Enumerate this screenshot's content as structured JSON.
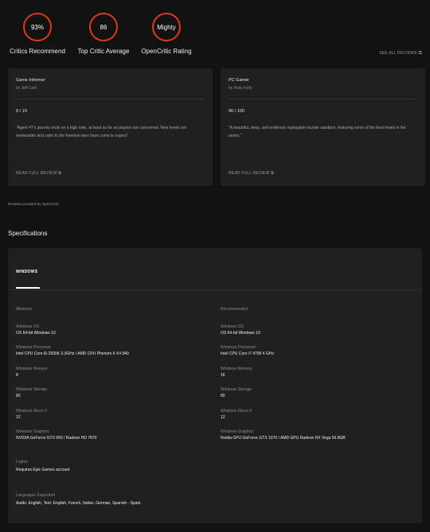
{
  "ratings": [
    {
      "value": "93%",
      "label": "Critics Recommend"
    },
    {
      "value": "86",
      "label": "Top Critic Average"
    },
    {
      "value": "Mighty",
      "label": "OpenCritic Rating"
    }
  ],
  "see_all_reviews": "SEE ALL REVIEWS",
  "reviews": [
    {
      "outlet": "Game Informer",
      "author": "by Jeff Cork",
      "score": "9 / 10",
      "quote": "“Agent 47’s journey ends on a high note, at least as far as players are concerned. New levels are memorable and cater to the freedom fans have come to expect”",
      "read_label": "READ FULL REVIEW"
    },
    {
      "outlet": "PC Gamer",
      "author": "by Andy Kelly",
      "score": "90 / 100",
      "quote": "“A beautiful, deep, and endlessly replayable murder sandbox, featuring some of the best levels in the series.”",
      "read_label": "READ FULL REVIEW"
    }
  ],
  "provided_by": "Reviews provided by OpenCritic",
  "specifications": {
    "title": "Specifications",
    "platform_tab": "WINDOWS",
    "minimum": {
      "heading": "Minimum",
      "items": [
        {
          "label": "Windows OS",
          "value": "OS 64-bit Windows 10"
        },
        {
          "label": "Windows Processor",
          "value": "Intel CPU Core i5-2500K 3.3GHz / AMD CPU Phenom II X4 940"
        },
        {
          "label": "Windows Memory",
          "value": "8"
        },
        {
          "label": "Windows Storage",
          "value": "80"
        },
        {
          "label": "Windows Direct X",
          "value": "12"
        },
        {
          "label": "Windows Graphics",
          "value": "NVIDIA GeForce GTX 660 / Radeon HD 7870"
        }
      ]
    },
    "recommended": {
      "heading": "Recommended",
      "items": [
        {
          "label": "Windows OS",
          "value": "OS 64-bit Windows 10"
        },
        {
          "label": "Windows Processor",
          "value": "Intel CPU Core i7 4790 4 GHz"
        },
        {
          "label": "Windows Memory",
          "value": "16"
        },
        {
          "label": "Windows Storage",
          "value": "80"
        },
        {
          "label": "Windows Direct X",
          "value": "12"
        },
        {
          "label": "Windows Graphics",
          "value": "Nvidia GPU GeForce GTX 1070 / AMD GPU Radeon RX Vega 56 8GB"
        }
      ]
    },
    "logins": {
      "label": "Logins",
      "value": "Requires Epic Games account"
    },
    "languages": {
      "label": "Languages Supported",
      "value": "Audio: English, Text: English, French, Italian, German, Spanish - Spain"
    }
  },
  "colors": {
    "accent": "#e0391b",
    "background": "#121212",
    "card": "#202020"
  },
  "icons": {
    "external": "external-link-icon"
  }
}
